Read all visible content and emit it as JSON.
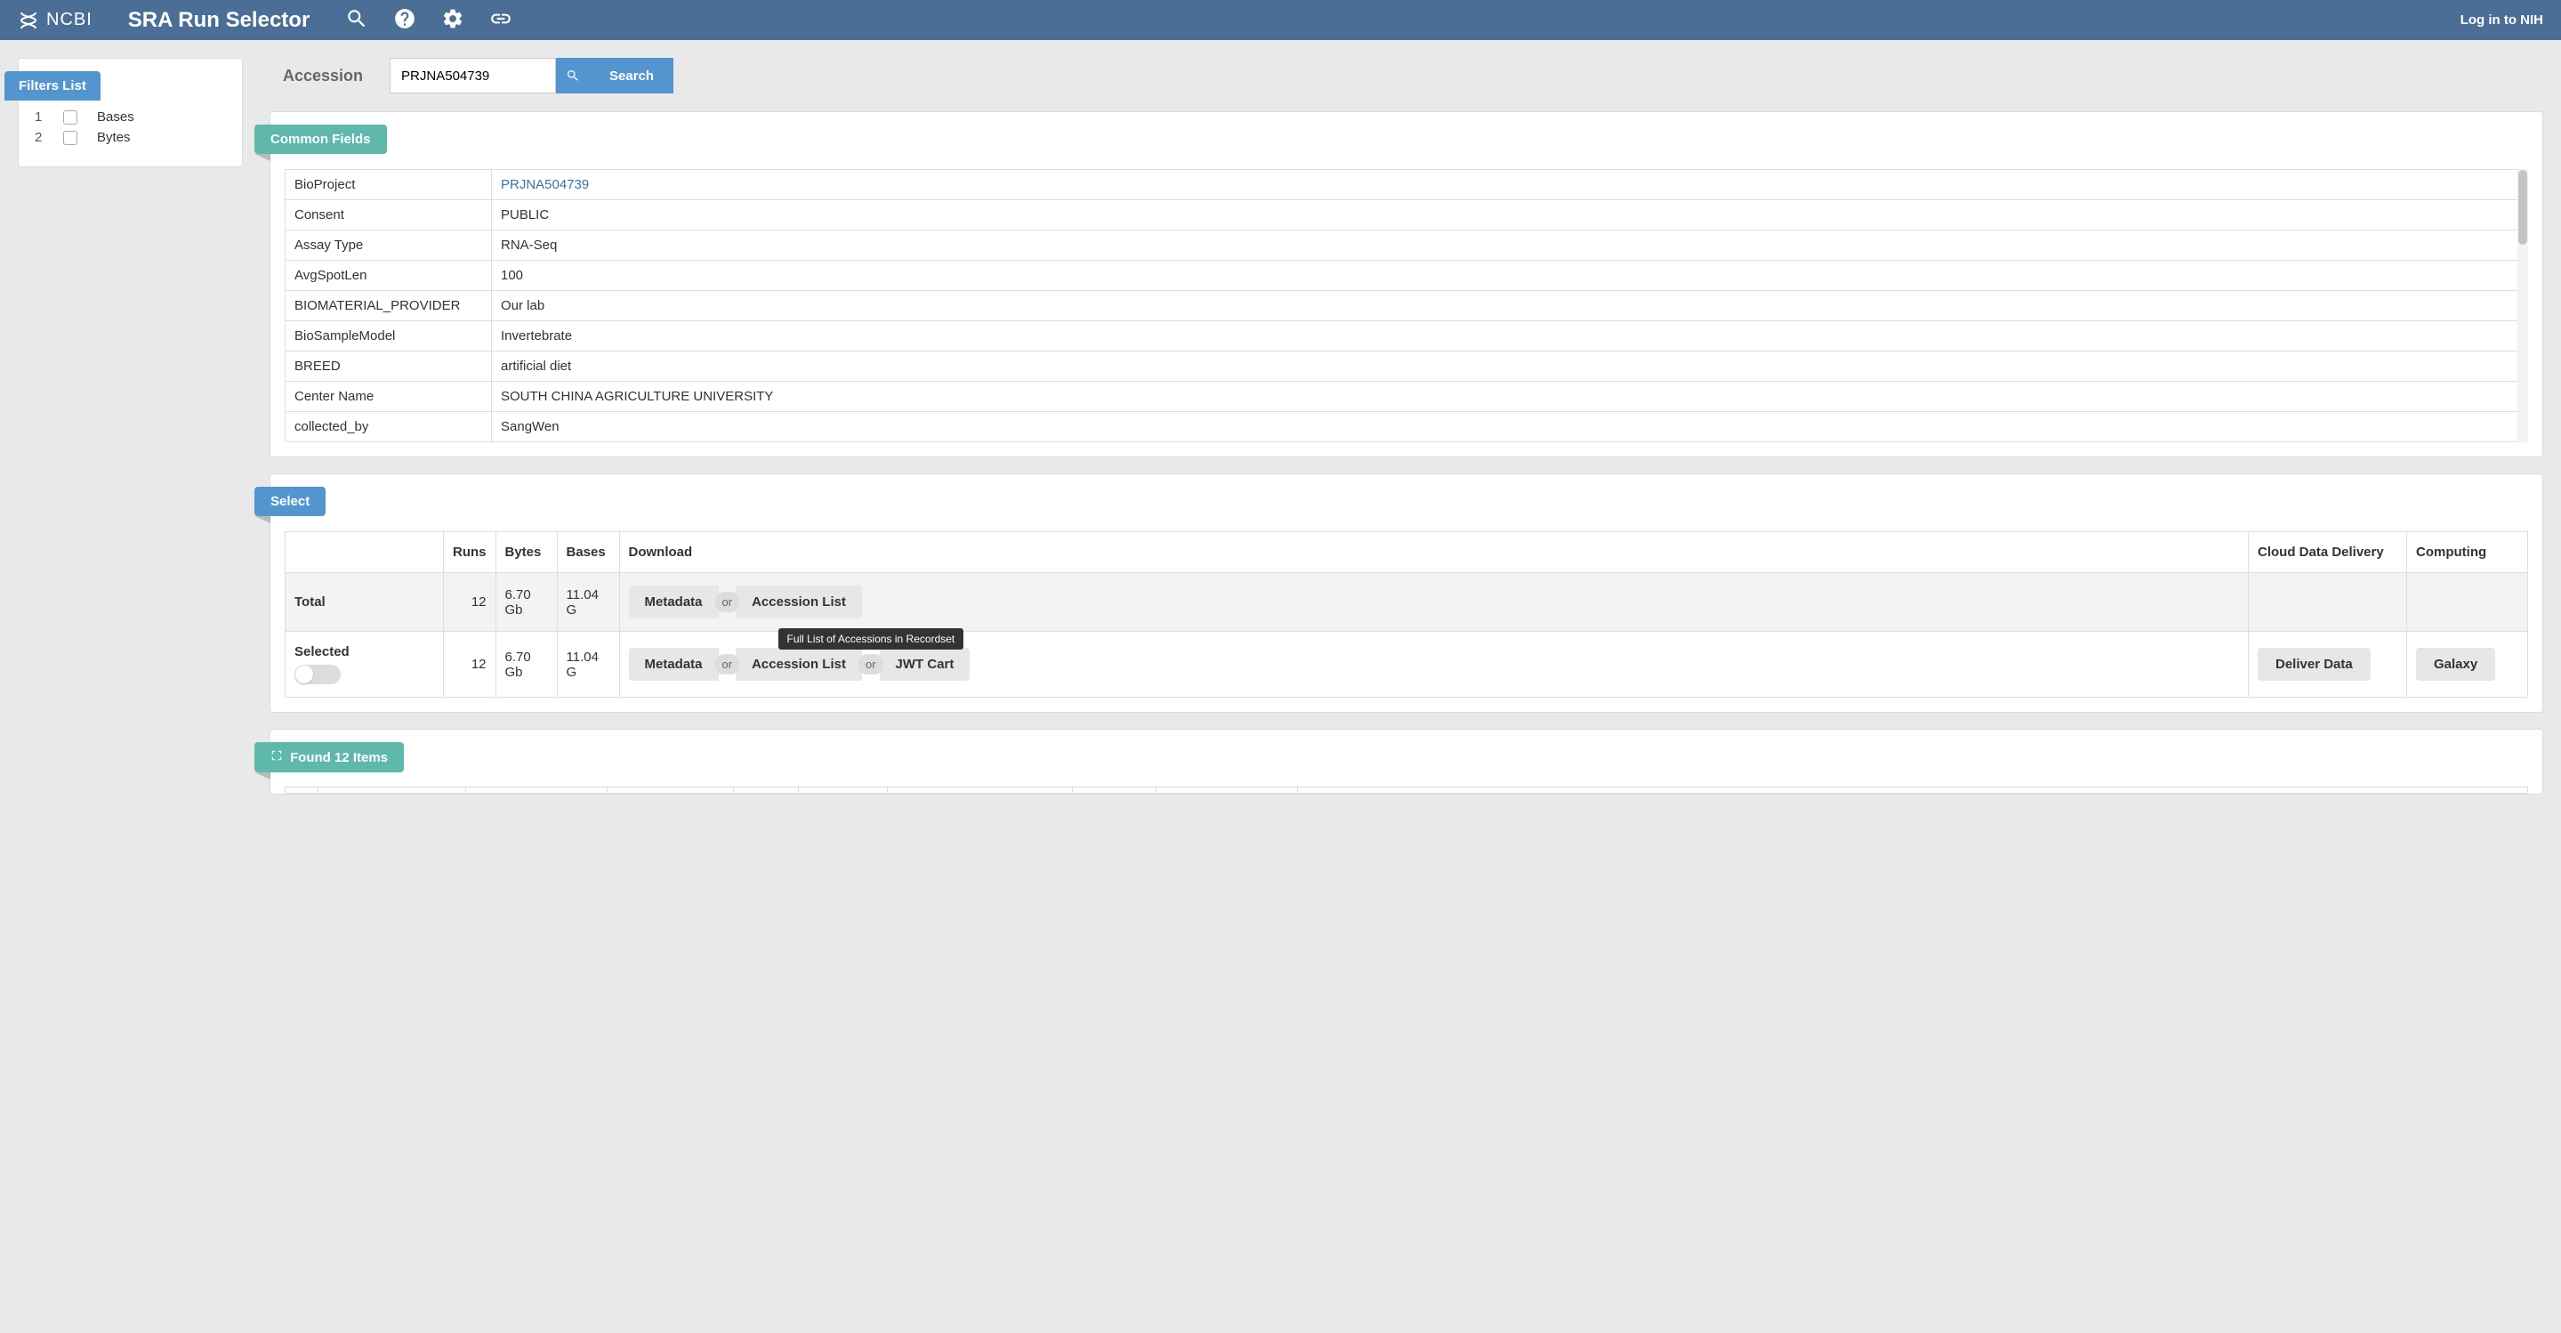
{
  "header": {
    "logo_text": "NCBI",
    "app_title": "SRA Run Selector",
    "login_text": "Log in to NIH"
  },
  "sidebar": {
    "filters_label": "Filters List",
    "items": [
      {
        "num": "1",
        "label": "Bases"
      },
      {
        "num": "2",
        "label": "Bytes"
      }
    ]
  },
  "search": {
    "accession_label": "Accession",
    "input_value": "PRJNA504739",
    "button_label": "Search"
  },
  "panels": {
    "common_fields_label": "Common Fields",
    "select_label": "Select",
    "found_label": "Found 12 Items"
  },
  "common_fields": [
    {
      "key": "BioProject",
      "value": "PRJNA504739",
      "link": true
    },
    {
      "key": "Consent",
      "value": "PUBLIC"
    },
    {
      "key": "Assay Type",
      "value": "RNA-Seq"
    },
    {
      "key": "AvgSpotLen",
      "value": "100"
    },
    {
      "key": "BIOMATERIAL_PROVIDER",
      "value": "Our lab"
    },
    {
      "key": "BioSampleModel",
      "value": "Invertebrate"
    },
    {
      "key": "BREED",
      "value": "artificial diet"
    },
    {
      "key": "Center Name",
      "value": "SOUTH CHINA AGRICULTURE UNIVERSITY"
    },
    {
      "key": "collected_by",
      "value": "SangWen"
    }
  ],
  "select_table": {
    "headers": {
      "runs": "Runs",
      "bytes": "Bytes",
      "bases": "Bases",
      "download": "Download",
      "cloud": "Cloud Data Delivery",
      "computing": "Computing"
    },
    "rows": {
      "total": {
        "label": "Total",
        "runs": "12",
        "bytes": "6.70 Gb",
        "bases": "11.04 G"
      },
      "selected": {
        "label": "Selected",
        "runs": "12",
        "bytes": "6.70 Gb",
        "bases": "11.04 G"
      }
    },
    "buttons": {
      "metadata": "Metadata",
      "accession_list": "Accession List",
      "jwt_cart": "JWT Cart",
      "or": "or",
      "deliver": "Deliver Data",
      "galaxy": "Galaxy"
    },
    "tooltip": "Full List of Accessions in Recordset"
  }
}
